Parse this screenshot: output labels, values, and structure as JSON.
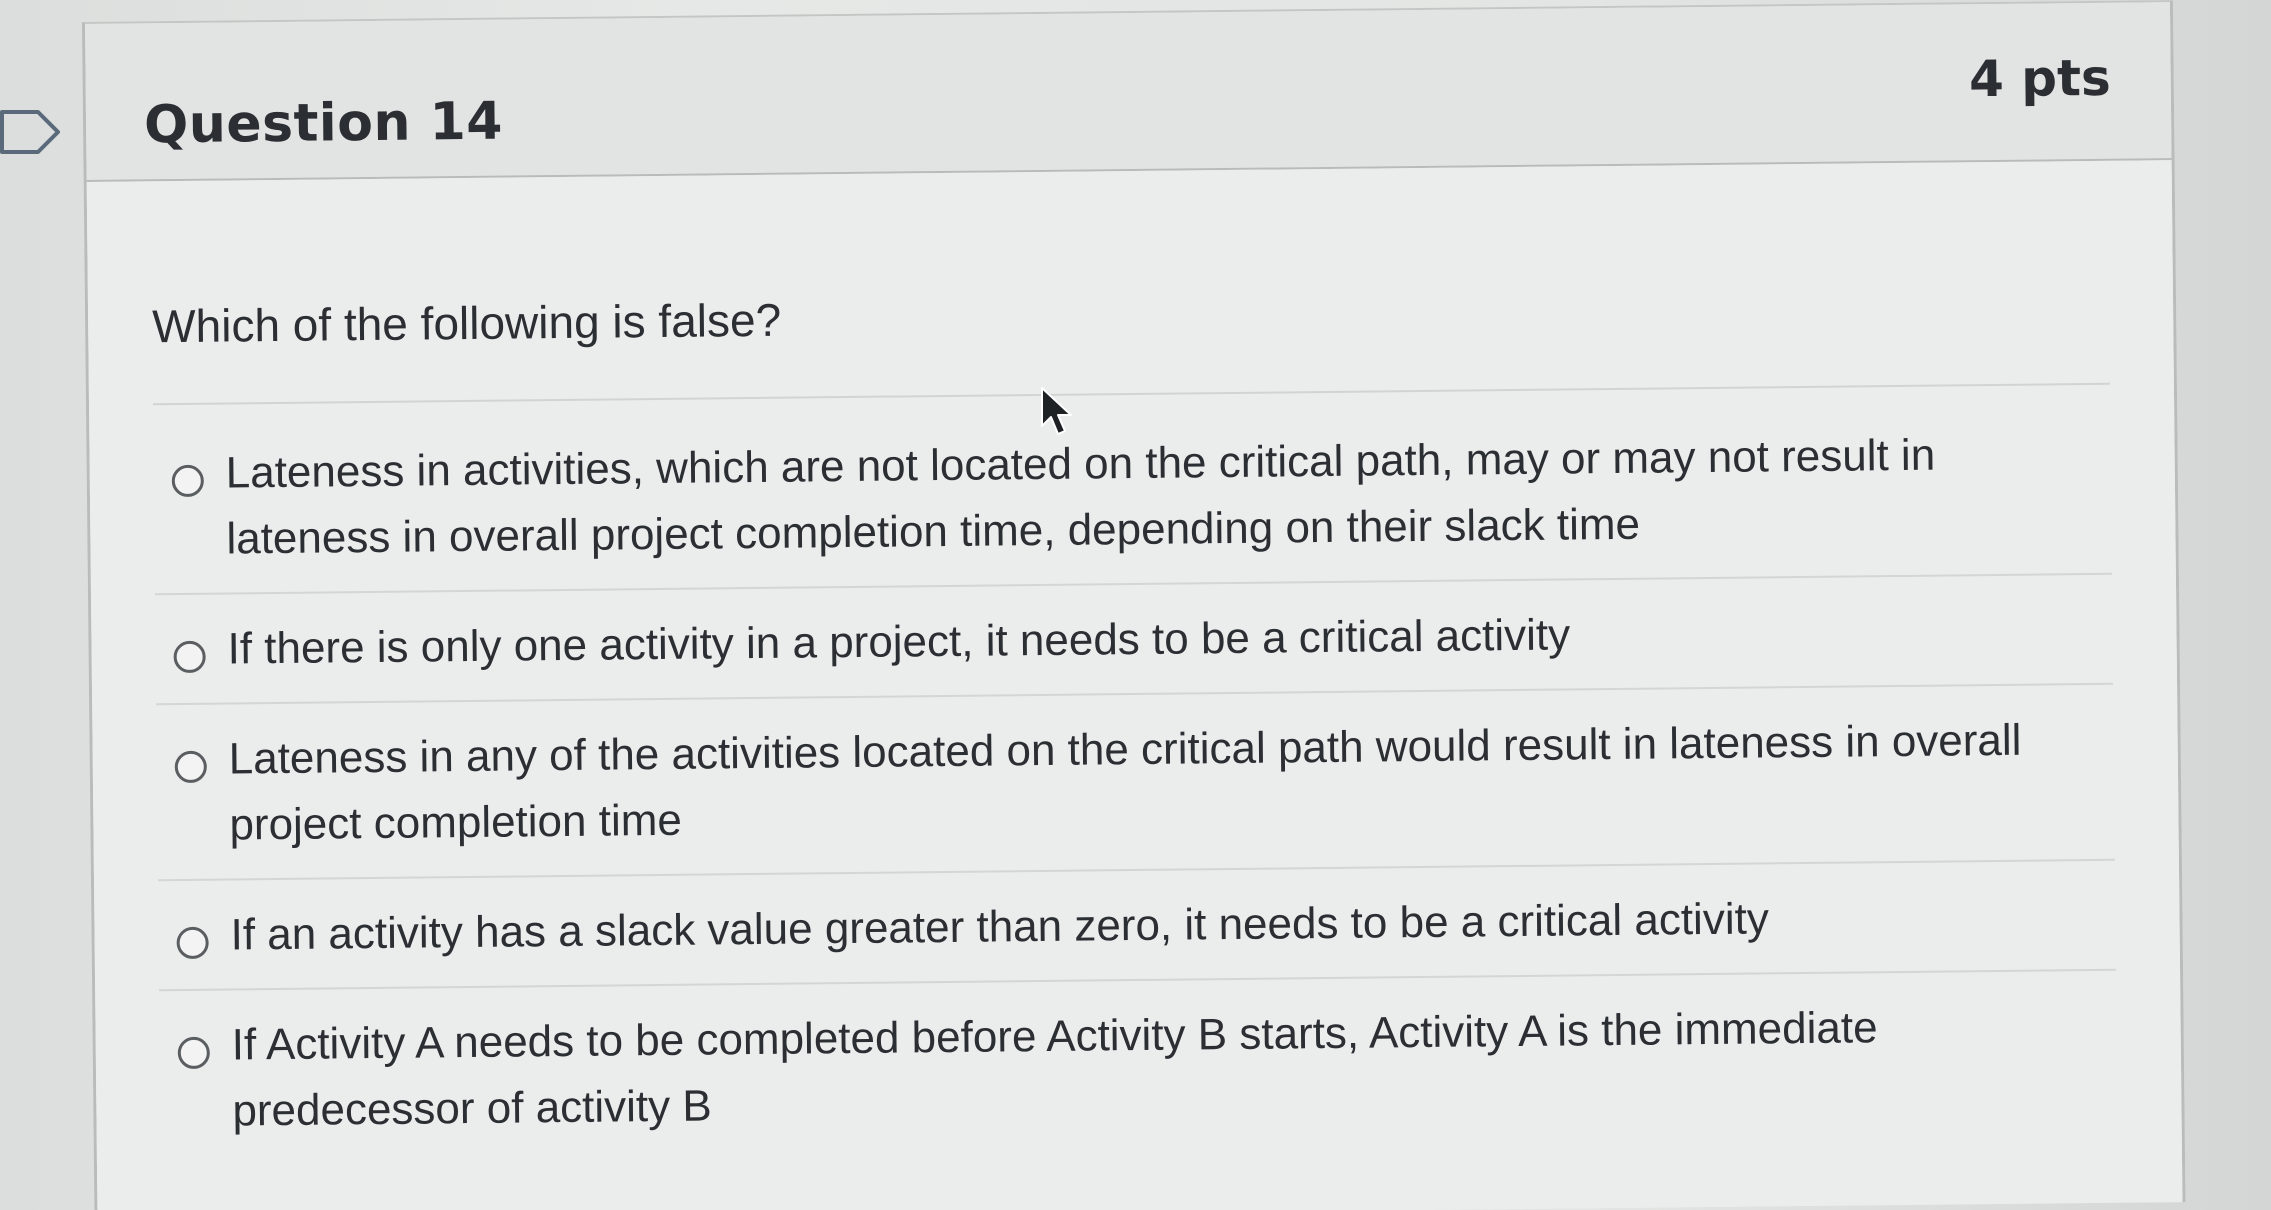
{
  "question": {
    "title": "Question 14",
    "points": "4 pts",
    "prompt": "Which of the following is false?"
  },
  "answers": [
    {
      "label": "Lateness in activities, which are not located on the critical path, may or may not result in lateness in overall project completion time, depending on their slack time"
    },
    {
      "label": "If there is only one activity in a project, it needs to be a critical activity"
    },
    {
      "label": "Lateness in any of the activities located on the critical path would result in lateness in overall project completion time"
    },
    {
      "label": "If an activity has a slack value greater than zero, it needs to be a critical activity"
    },
    {
      "label": "If Activity A needs to be completed before Activity B starts, Activity A is the immediate predecessor of activity B"
    }
  ],
  "icons": {
    "flag": "flag-question-icon",
    "cursor": "mouse-pointer-icon"
  },
  "colors": {
    "text": "#2b2f33",
    "background": "#e9ebea",
    "border": "#b9bcbb"
  }
}
